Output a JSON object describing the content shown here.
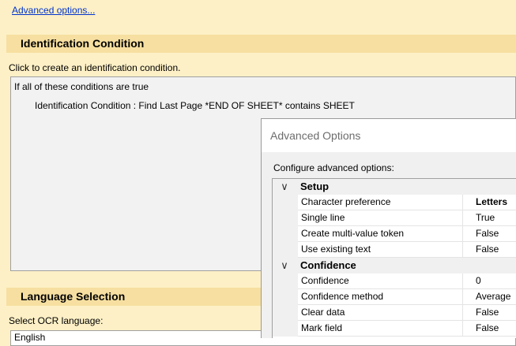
{
  "advanced_link": "Advanced options...",
  "identification": {
    "header": "Identification Condition",
    "hint": "Click to create an identification condition.",
    "lines": [
      "If all of these conditions are true",
      "Identification Condition : Find Last Page *END OF SHEET* contains SHEET"
    ]
  },
  "language": {
    "header": "Language Selection",
    "hint": "Select OCR language:",
    "value": "English"
  },
  "dialog": {
    "title": "Advanced Options",
    "caption": "Configure advanced options:",
    "categories": [
      {
        "name": "Setup",
        "properties": [
          {
            "name": "Character preference",
            "value": "Letters",
            "bold": true
          },
          {
            "name": "Single line",
            "value": "True"
          },
          {
            "name": "Create multi-value token",
            "value": "False"
          },
          {
            "name": "Use existing text",
            "value": "False"
          }
        ]
      },
      {
        "name": "Confidence",
        "properties": [
          {
            "name": "Confidence",
            "value": "0"
          },
          {
            "name": "Confidence method",
            "value": "Average"
          },
          {
            "name": "Clear data",
            "value": "False"
          },
          {
            "name": "Mark field",
            "value": "False"
          }
        ]
      }
    ]
  },
  "icons": {
    "expanded": "chevron-down-icon"
  }
}
